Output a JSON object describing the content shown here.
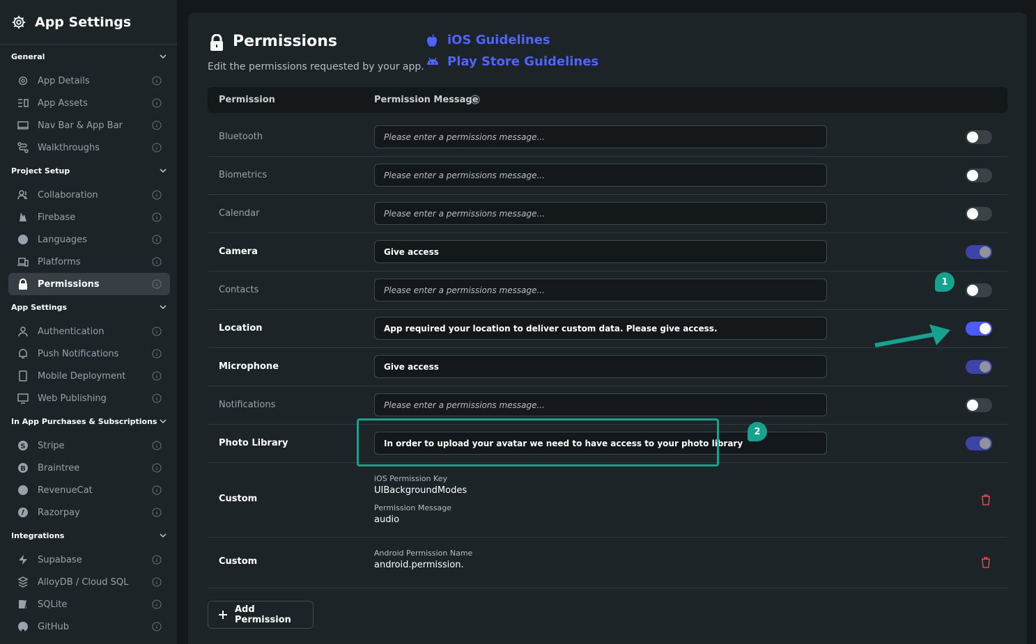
{
  "sidebar": {
    "title": "App Settings",
    "sections": [
      {
        "label": "General",
        "items": [
          {
            "label": "App Details",
            "icon": "gear-icon"
          },
          {
            "label": "App Assets",
            "icon": "assets-icon"
          },
          {
            "label": "Nav Bar & App Bar",
            "icon": "navbar-icon"
          },
          {
            "label": "Walkthroughs",
            "icon": "route-icon"
          }
        ]
      },
      {
        "label": "Project Setup",
        "items": [
          {
            "label": "Collaboration",
            "icon": "users-icon"
          },
          {
            "label": "Firebase",
            "icon": "firebase-icon"
          },
          {
            "label": "Languages",
            "icon": "globe-icon"
          },
          {
            "label": "Platforms",
            "icon": "devices-icon"
          },
          {
            "label": "Permissions",
            "icon": "lock-icon"
          }
        ]
      },
      {
        "label": "App Settings",
        "items": [
          {
            "label": "Authentication",
            "icon": "user-icon"
          },
          {
            "label": "Push Notifications",
            "icon": "bell-icon"
          },
          {
            "label": "Mobile Deployment",
            "icon": "mobile-icon"
          },
          {
            "label": "Web Publishing",
            "icon": "monitor-icon"
          }
        ]
      },
      {
        "label": "In App Purchases & Subscriptions",
        "items": [
          {
            "label": "Stripe",
            "icon": "stripe-icon"
          },
          {
            "label": "Braintree",
            "icon": "braintree-icon"
          },
          {
            "label": "RevenueCat",
            "icon": "revenuecat-icon"
          },
          {
            "label": "Razorpay",
            "icon": "razorpay-icon"
          }
        ]
      },
      {
        "label": "Integrations",
        "items": [
          {
            "label": "Supabase",
            "icon": "bolt-icon"
          },
          {
            "label": "AlloyDB / Cloud SQL",
            "icon": "database-icon"
          },
          {
            "label": "SQLite",
            "icon": "sqlite-icon"
          },
          {
            "label": "GitHub",
            "icon": "github-icon"
          }
        ]
      }
    ]
  },
  "header": {
    "title": "Permissions",
    "subtitle": "Edit the permissions requested by your app.",
    "ios_link": "iOS Guidelines",
    "play_link": "Play Store Guidelines"
  },
  "table": {
    "col_permission": "Permission",
    "col_message": "Permission Message",
    "placeholder": "Please enter a permissions message...",
    "rows": [
      {
        "name": "Bluetooth",
        "message": "",
        "state": "off"
      },
      {
        "name": "Biometrics",
        "message": "",
        "state": "off"
      },
      {
        "name": "Calendar",
        "message": "",
        "state": "off"
      },
      {
        "name": "Camera",
        "message": "Give access",
        "state": "on"
      },
      {
        "name": "Contacts",
        "message": "",
        "state": "off"
      },
      {
        "name": "Location",
        "message": "App required your location to deliver custom data. Please give access.",
        "state": "active"
      },
      {
        "name": "Microphone",
        "message": "Give access",
        "state": "on"
      },
      {
        "name": "Notifications",
        "message": "",
        "state": "off"
      },
      {
        "name": "Photo Library",
        "message": "In order to upload your avatar we need to have access to your photo library",
        "state": "on"
      }
    ],
    "custom_ios": {
      "name": "Custom",
      "key_label": "iOS Permission Key",
      "key_value": "UIBackgroundModes",
      "msg_label": "Permission Message",
      "msg_value": "audio"
    },
    "custom_android": {
      "name": "Custom",
      "key_label": "Android Permission Name",
      "key_value": "android.permission."
    }
  },
  "add_button": "Add Permission",
  "annotations": {
    "badge1": "1",
    "badge2": "2"
  },
  "colors": {
    "accent": "#4b5bff",
    "annotation": "#14a38f",
    "danger": "#e5484d"
  }
}
